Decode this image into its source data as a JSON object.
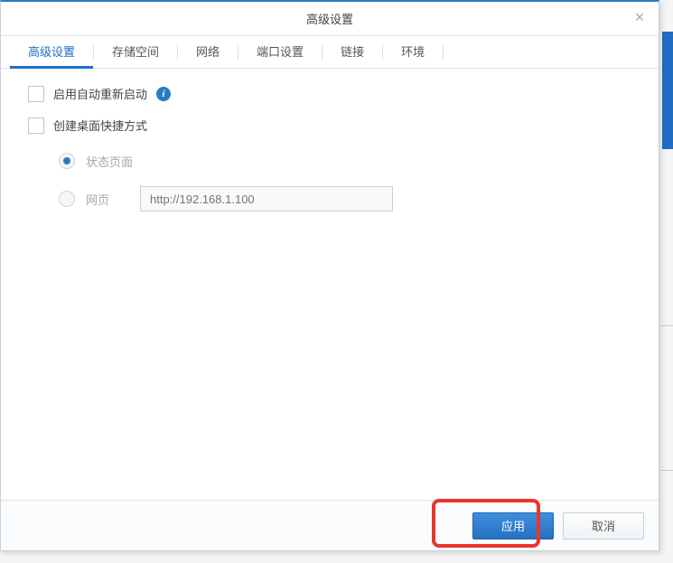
{
  "header": {
    "title": "高级设置"
  },
  "tabs": {
    "advanced": "高级设置",
    "storage": "存储空间",
    "network": "网络",
    "port": "端口设置",
    "links": "链接",
    "environment": "环境"
  },
  "options": {
    "autoRestart": "启用自动重新启动",
    "createShortcut": "创建桌面快捷方式"
  },
  "shortcut": {
    "statusPage": "状态页面",
    "webPage": "网页",
    "urlPlaceholder": "http://192.168.1.100"
  },
  "footer": {
    "apply": "应用",
    "cancel": "取消"
  }
}
